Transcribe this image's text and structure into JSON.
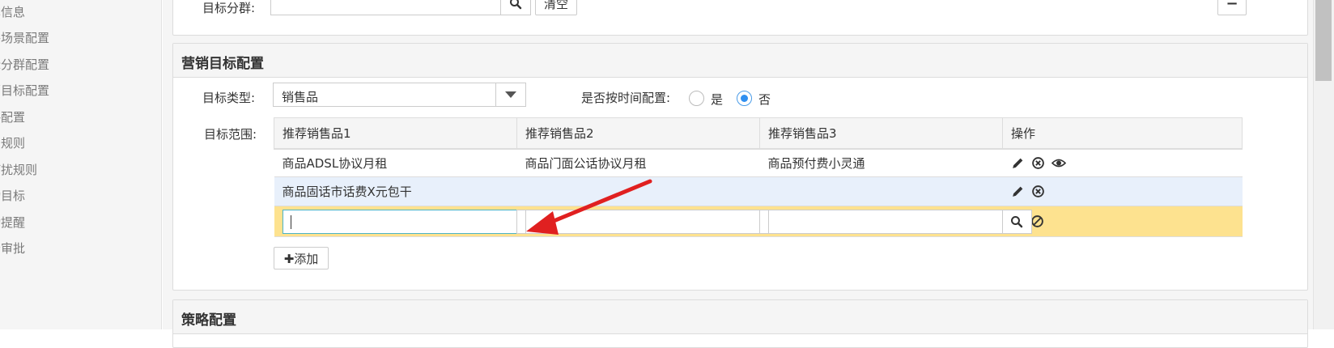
{
  "sidebar": {
    "items": [
      {
        "label": "本信息"
      },
      {
        "label": "件场景配置"
      },
      {
        "label": "标分群配置"
      },
      {
        "label": "销目标配置"
      },
      {
        "label": "略配置"
      },
      {
        "label": "法规则"
      },
      {
        "label": "打扰规则"
      },
      {
        "label": "动目标"
      },
      {
        "label": "动提醒"
      },
      {
        "label": "务审批"
      }
    ]
  },
  "top_panel": {
    "group_label": "目标分群:",
    "group_value": "",
    "clear_label": "清空",
    "collapse_label": "−"
  },
  "marketing": {
    "title": "营销目标配置",
    "type_label": "目标类型:",
    "type_value": "销售品",
    "time_config_label": "是否按时间配置:",
    "radio_yes": "是",
    "radio_no": "否",
    "radio_selected": "否",
    "range_label": "目标范围:",
    "table": {
      "headers": [
        "推荐销售品1",
        "推荐销售品2",
        "推荐销售品3",
        "操作"
      ],
      "rows": [
        [
          "商品ADSL协议月租",
          "商品门面公话协议月租",
          "商品预付费小灵通"
        ],
        [
          "商品固话市话费X元包干",
          "",
          ""
        ]
      ]
    },
    "add_label": "✚添加"
  },
  "strategy": {
    "title": "策略配置"
  },
  "colors": {
    "accent": "#2f8ff0",
    "editing_row": "#fde28f",
    "selected_row": "#e8f0fb",
    "annotation_arrow": "#e02020"
  }
}
